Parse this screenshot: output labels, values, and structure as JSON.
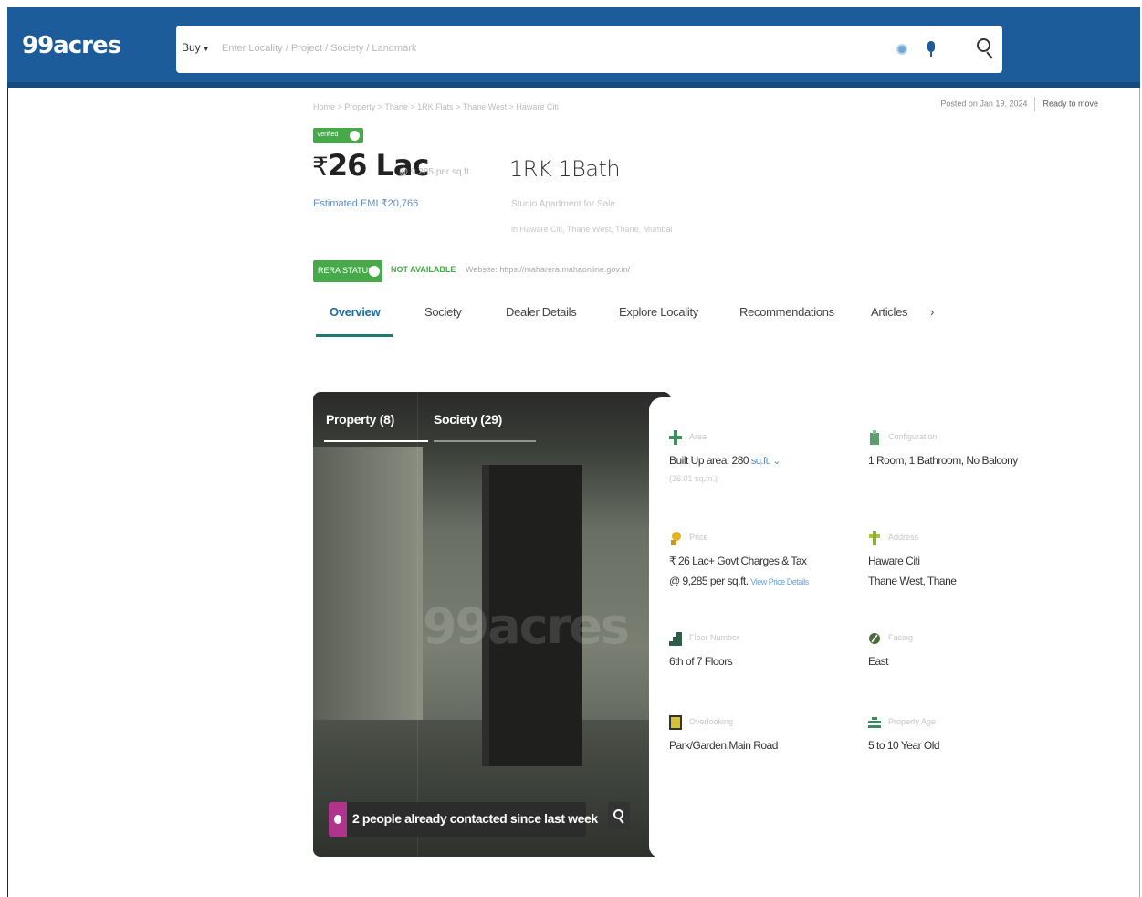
{
  "header": {
    "logo": "99acres",
    "buy_label": "Buy",
    "search_placeholder": "Enter Locality / Project / Society / Landmark"
  },
  "meta": {
    "breadcrumb": "Home > Property > Thane > 1RK Flats > Thane West > Haware Citi",
    "posted": "Posted on Jan 19, 2024",
    "possession": "Ready to move"
  },
  "listing": {
    "verified_label": "Verified",
    "price": "26 Lac",
    "price_per_sqft": "@ 9,285 per sq.ft.",
    "emi": "Estimated EMI ₹20,766",
    "configuration": "1RK 1Bath",
    "property_type": "Studio Apartment for Sale",
    "address": "in Haware Citi, Thane West, Thane, Mumbai",
    "rera_label": "RERA STATUS",
    "rera_status": "NOT AVAILABLE",
    "rera_website": "Website: https://maharera.mahaonline.gov.in/"
  },
  "tabs": [
    {
      "label": "Overview"
    },
    {
      "label": "Society"
    },
    {
      "label": "Dealer Details"
    },
    {
      "label": "Explore Locality"
    },
    {
      "label": "Recommendations"
    },
    {
      "label": "Articles"
    }
  ],
  "tabs_next": "›",
  "photo": {
    "tab_property": "Property (8)",
    "tab_society": "Society (29)",
    "watermark": "99acres",
    "contact_banner": "2 people already contacted since last week"
  },
  "details": {
    "area": {
      "label": "Area",
      "value": "Built Up area: 280",
      "unit": "sq.ft.",
      "sub": "(26.01 sq.m.)",
      "icon": "area-icon",
      "color": "#3a8f5a"
    },
    "configuration": {
      "label": "Configuration",
      "value": "1 Room, 1 Bathroom, No Balcony",
      "icon": "configuration-icon",
      "color": "#5c9e6c"
    },
    "price": {
      "label": "Price",
      "value": "₹ 26 Lac+ Govt Charges & Tax",
      "value2": "@ 9,285 per sq.ft.",
      "link": "View Price Details",
      "icon": "price-icon",
      "color": "#e0b224"
    },
    "address": {
      "label": "Address",
      "value": "Haware Citi",
      "value2": "Thane West, Thane",
      "icon": "address-icon",
      "color": "#a0c63a"
    },
    "floor": {
      "label": "Floor Number",
      "value": "6th  of 7 Floors",
      "icon": "floor-icon",
      "color": "#2e5e4a"
    },
    "facing": {
      "label": "Facing",
      "value": "East",
      "icon": "facing-icon",
      "color": "#4b6b3a"
    },
    "overlooking": {
      "label": "Overlooking",
      "value": "Park/Garden,Main Road",
      "icon": "overlooking-icon",
      "color": "#d6c23a"
    },
    "property_age": {
      "label": "Property Age",
      "value": "5 to 10 Year Old",
      "icon": "property-age-icon",
      "color": "#3d8a5e"
    }
  }
}
